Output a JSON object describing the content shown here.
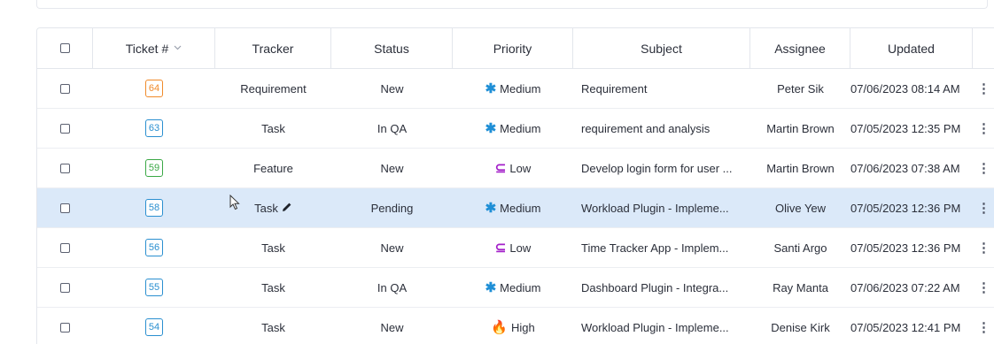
{
  "table": {
    "headers": {
      "ticket": "Ticket #",
      "sort_icon": "chevron-down-icon",
      "tracker": "Tracker",
      "status": "Status",
      "priority": "Priority",
      "subject": "Subject",
      "assignee": "Assignee",
      "updated": "Updated"
    },
    "priority_styles": {
      "Medium": {
        "icon": "snowflake-icon",
        "glyph": "✱",
        "color": "#1f8fd6"
      },
      "Low": {
        "icon": "low-priority-icon",
        "glyph": "⊆",
        "color": "#a31fc9"
      },
      "High": {
        "icon": "flame-icon",
        "glyph": "🔥",
        "color": "#e0461a"
      }
    },
    "rows": [
      {
        "ticket": "64",
        "badge_color": "#f08a2a",
        "tracker": "Requirement",
        "status": "New",
        "priority": "Medium",
        "subject": "Requirement",
        "assignee": "Peter Sik",
        "updated": "07/06/2023 08:14 AM",
        "selected": false
      },
      {
        "ticket": "63",
        "badge_color": "#2a8fd0",
        "tracker": "Task",
        "status": "In QA",
        "priority": "Medium",
        "subject": "requirement and analysis",
        "assignee": "Martin Brown",
        "updated": "07/05/2023 12:35 PM",
        "selected": false
      },
      {
        "ticket": "59",
        "badge_color": "#3aa845",
        "tracker": "Feature",
        "status": "New",
        "priority": "Low",
        "subject": "Develop login form for user ...",
        "assignee": "Martin Brown",
        "updated": "07/06/2023 07:38 AM",
        "selected": false
      },
      {
        "ticket": "58",
        "badge_color": "#2a8fd0",
        "tracker": "Task",
        "status": "Pending",
        "priority": "Medium",
        "subject": "Workload Plugin - Impleme...",
        "assignee": "Olive Yew",
        "updated": "07/05/2023 12:36 PM",
        "selected": true
      },
      {
        "ticket": "56",
        "badge_color": "#2a8fd0",
        "tracker": "Task",
        "status": "New",
        "priority": "Low",
        "subject": "Time Tracker App - Implem...",
        "assignee": "Santi Argo",
        "updated": "07/05/2023 12:36 PM",
        "selected": false
      },
      {
        "ticket": "55",
        "badge_color": "#2a8fd0",
        "tracker": "Task",
        "status": "In QA",
        "priority": "Medium",
        "subject": "Dashboard Plugin - Integra...",
        "assignee": "Ray Manta",
        "updated": "07/06/2023 07:22 AM",
        "selected": false
      },
      {
        "ticket": "54",
        "badge_color": "#2a8fd0",
        "tracker": "Task",
        "status": "New",
        "priority": "High",
        "subject": "Workload Plugin - Impleme...",
        "assignee": "Denise Kirk",
        "updated": "07/05/2023 12:41 PM",
        "selected": false
      }
    ],
    "row_actions_icon": "kebab-menu-icon",
    "edit_icon": "pencil-icon",
    "selected_row_color": "#dbe9f9"
  }
}
